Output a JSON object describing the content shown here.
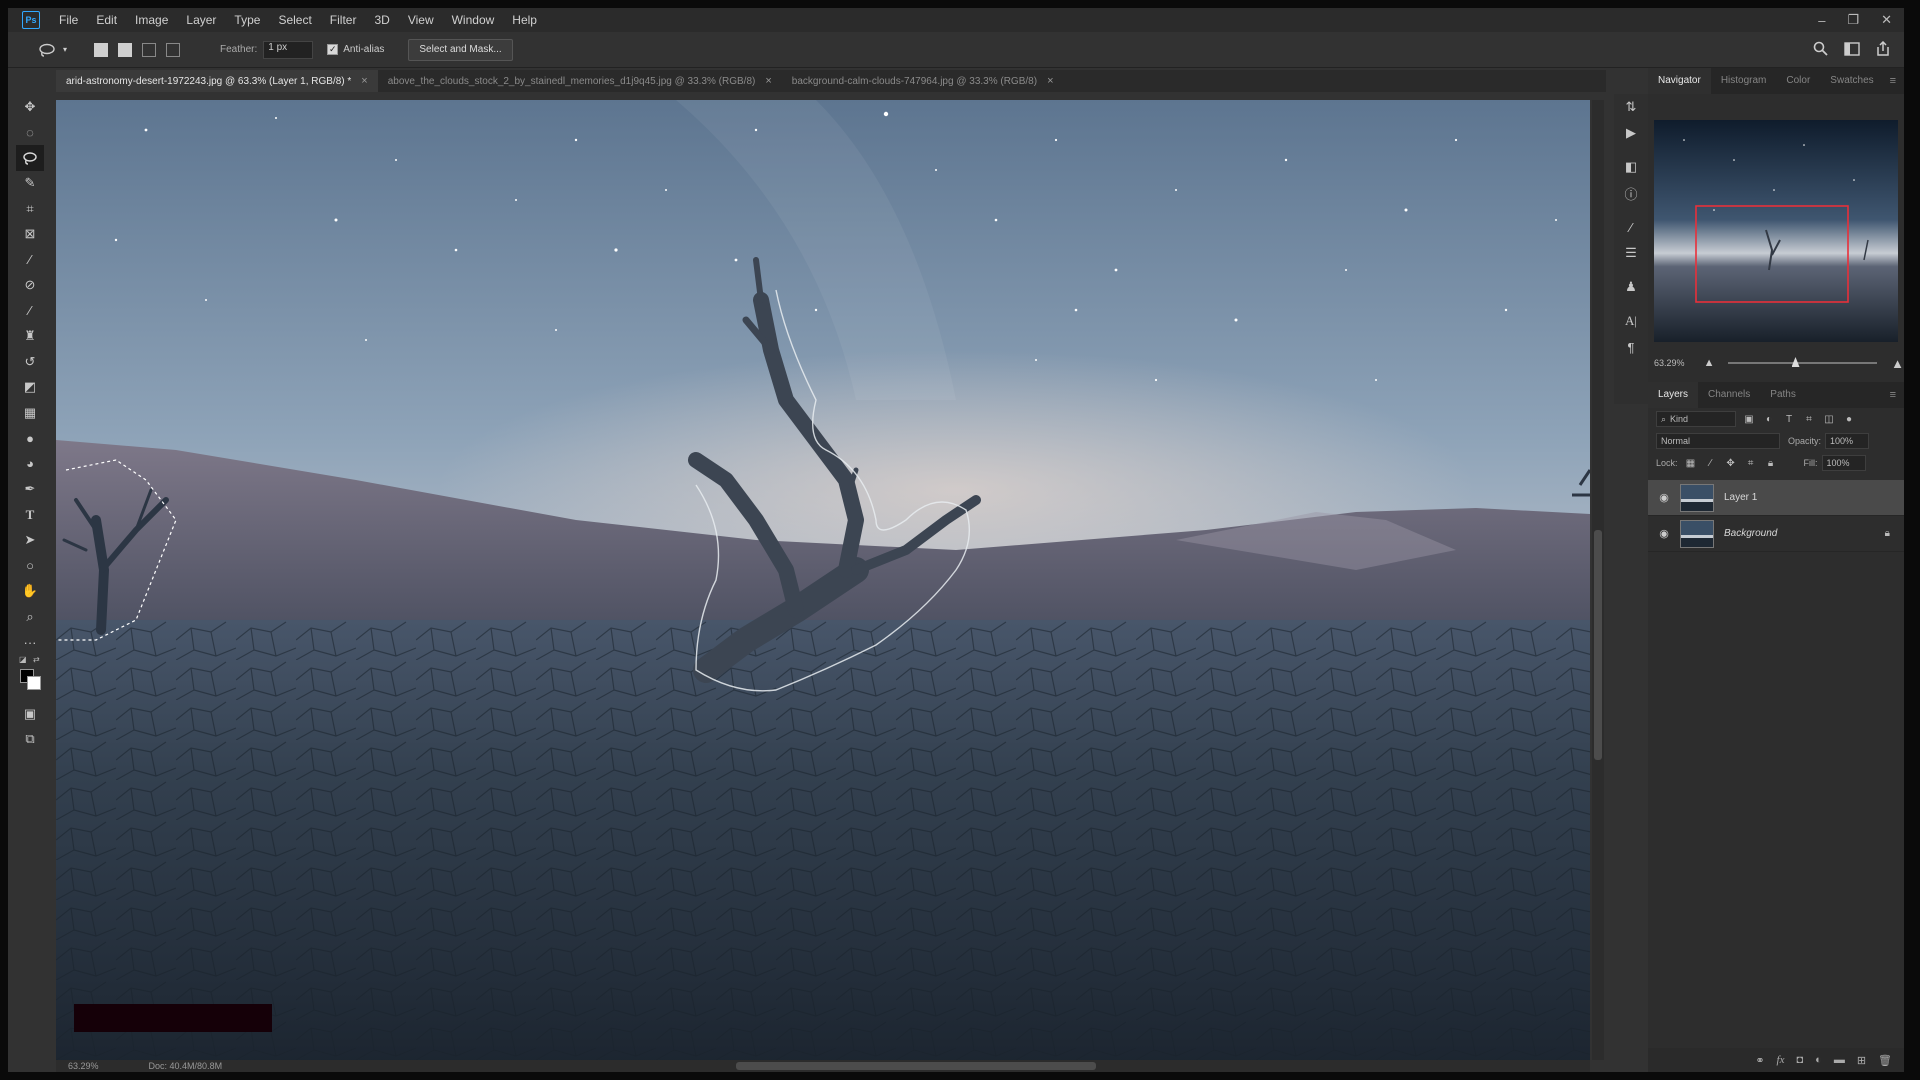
{
  "app": {
    "logo": "Ps"
  },
  "menu": [
    "File",
    "Edit",
    "Image",
    "Layer",
    "Type",
    "Select",
    "Filter",
    "3D",
    "View",
    "Window",
    "Help"
  ],
  "window_controls": {
    "minimize": "–",
    "restore": "❐",
    "close": "✕"
  },
  "options_bar": {
    "feather_label": "Feather:",
    "feather_value": "1 px",
    "antialias_label": "Anti-alias",
    "antialias_checked": true,
    "select_mask_label": "Select and Mask..."
  },
  "tabs": [
    {
      "label": "arid-astronomy-desert-1972243.jpg @ 63.3% (Layer 1, RGB/8) *",
      "active": true
    },
    {
      "label": "above_the_clouds_stock_2_by_stainedl_memories_d1j9q45.jpg @ 33.3% (RGB/8)",
      "active": false
    },
    {
      "label": "background-calm-clouds-747964.jpg @ 33.3% (RGB/8)",
      "active": false
    }
  ],
  "tab_close": "×",
  "status": {
    "zoom": "63.29%",
    "doc": "Doc: 40.4M/80.8M"
  },
  "panels": {
    "top_tabs": [
      "Navigator",
      "Histogram",
      "Color",
      "Swatches"
    ],
    "navigator_zoom": "63.29%",
    "navigator_zoom_fraction": 0.45,
    "layer_tabs": [
      "Layers",
      "Channels",
      "Paths"
    ],
    "filter_kind": "Kind",
    "blend_mode": "Normal",
    "opacity_label": "Opacity:",
    "opacity_value": "100%",
    "lock_label": "Lock:",
    "fill_label": "Fill:",
    "fill_value": "100%",
    "layers": [
      {
        "name": "Layer 1",
        "selected": true,
        "visible": true
      },
      {
        "name": "Background",
        "selected": false,
        "visible": true,
        "locked": true
      }
    ]
  },
  "colors": {
    "accent": "#31a8ff",
    "navigator_box": "#e8303a",
    "foreground": "#000000",
    "background": "#ffffff"
  }
}
